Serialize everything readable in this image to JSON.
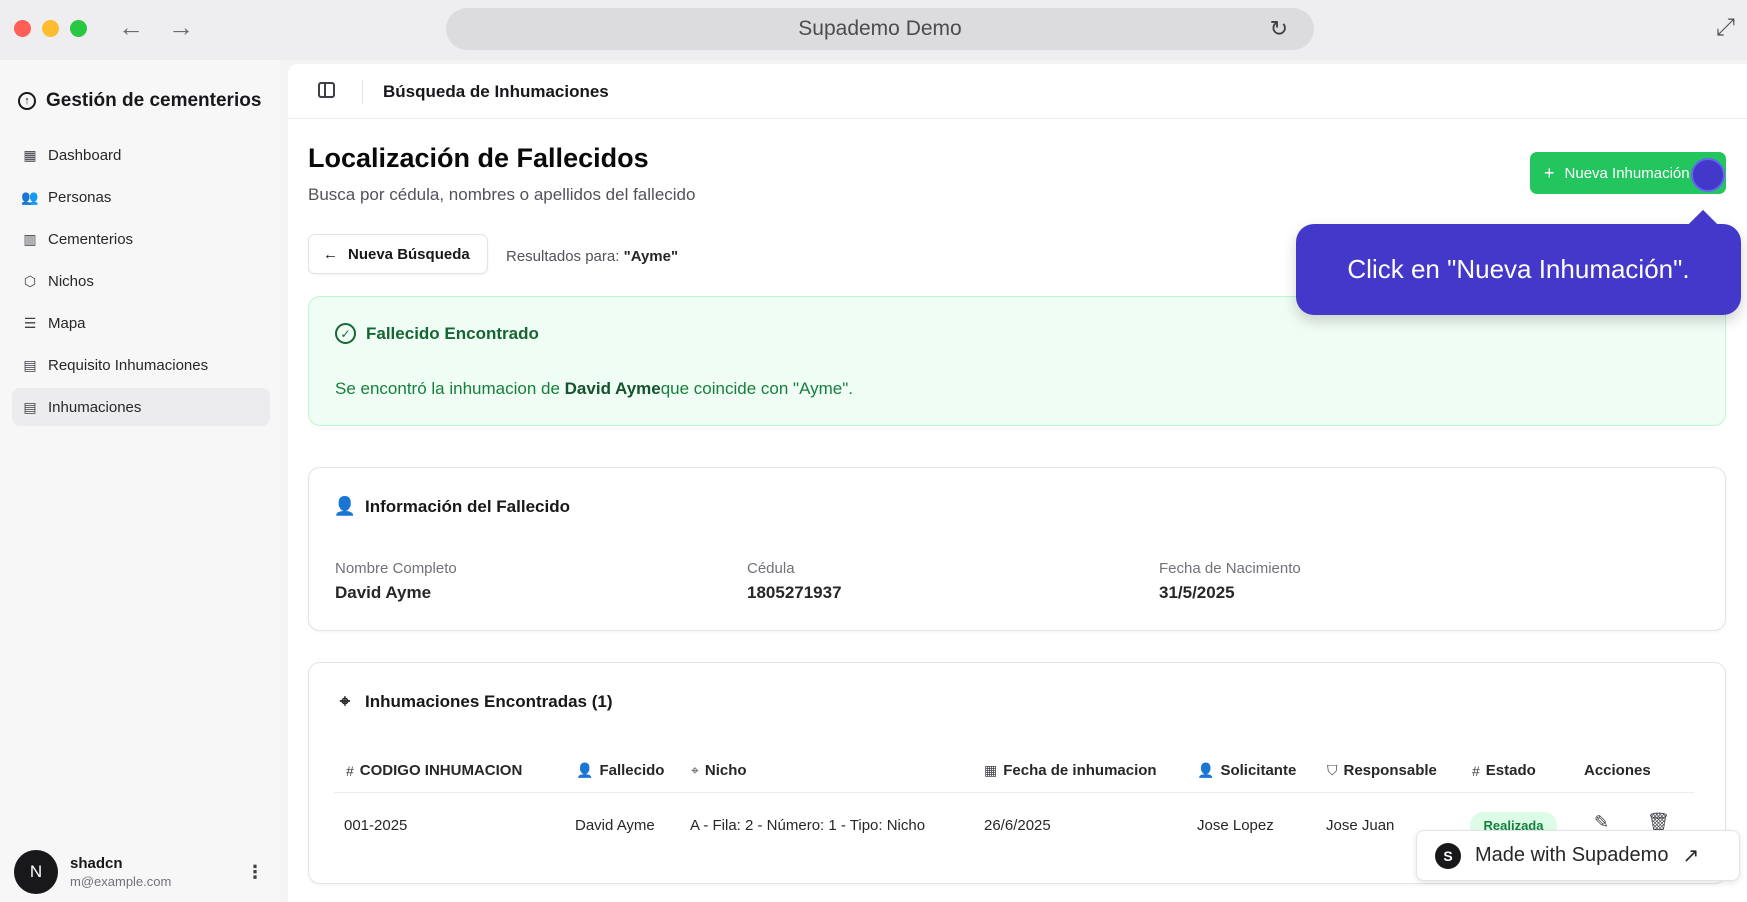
{
  "browser": {
    "title": "Supademo Demo",
    "back_icon": "←",
    "forward_icon": "→",
    "reload_icon": "↻",
    "expand_icon": "⤢"
  },
  "sidebar": {
    "brand": "Gestión de cementerios",
    "items": [
      {
        "label": "Dashboard",
        "icon": "▦"
      },
      {
        "label": "Personas",
        "icon": "👥"
      },
      {
        "label": "Cementerios",
        "icon": "▥"
      },
      {
        "label": "Nichos",
        "icon": "⬡"
      },
      {
        "label": "Mapa",
        "icon": "☰"
      },
      {
        "label": "Requisito Inhumaciones",
        "icon": "▤"
      },
      {
        "label": "Inhumaciones",
        "icon": "▤"
      }
    ],
    "active_item": "Inhumaciones",
    "user": {
      "initial": "N",
      "name": "shadcn",
      "email": "m@example.com"
    }
  },
  "topbar": {
    "title": "Búsqueda de Inhumaciones"
  },
  "page": {
    "title": "Localización de Fallecidos",
    "subtitle": "Busca por cédula, nombres o apellidos del fallecido",
    "new_button": "Nueva Inhumación",
    "back_button": "Nueva Búsqueda",
    "results_prefix": "Resultados para: ",
    "results_query": "\"Ayme\""
  },
  "found": {
    "title": "Fallecido Encontrado",
    "msg_prefix": "Se encontró la inhumacion de ",
    "msg_name": "David Ayme",
    "msg_suffix": "que coincide con \"Ayme\"."
  },
  "tooltip": {
    "text": "Click en \"Nueva Inhumación\"."
  },
  "info": {
    "title": "Información del Fallecido",
    "fields": [
      {
        "label": "Nombre Completo",
        "value": "David Ayme"
      },
      {
        "label": "Cédula",
        "value": "1805271937"
      },
      {
        "label": "Fecha de Nacimiento",
        "value": "31/5/2025"
      }
    ]
  },
  "table": {
    "title": "Inhumaciones Encontradas (1)",
    "headers": [
      {
        "label": "CODIGO INHUMACION",
        "icon": "#"
      },
      {
        "label": "Fallecido",
        "icon": "👤"
      },
      {
        "label": "Nicho",
        "icon": "⌖"
      },
      {
        "label": "Fecha de inhumacion",
        "icon": "▦"
      },
      {
        "label": "Solicitante",
        "icon": "👤"
      },
      {
        "label": "Responsable",
        "icon": "⛉"
      },
      {
        "label": "Estado",
        "icon": "#"
      },
      {
        "label": "Acciones",
        "icon": ""
      }
    ],
    "rows": [
      {
        "codigo": "001-2025",
        "fallecido": "David Ayme",
        "nicho": "A - Fila: 2 - Número: 1 - Tipo: Nicho",
        "fecha": "26/6/2025",
        "solicitante": "Jose Lopez",
        "responsable": "Jose Juan",
        "estado": "Realizada"
      }
    ]
  },
  "supademo": {
    "logo": "S",
    "label": "Made with Supademo",
    "arrow": "↗"
  },
  "colors": {
    "accent_green": "#22c55e",
    "tooltip_bg": "#4338ca",
    "found_bg": "#f0fdf4"
  }
}
